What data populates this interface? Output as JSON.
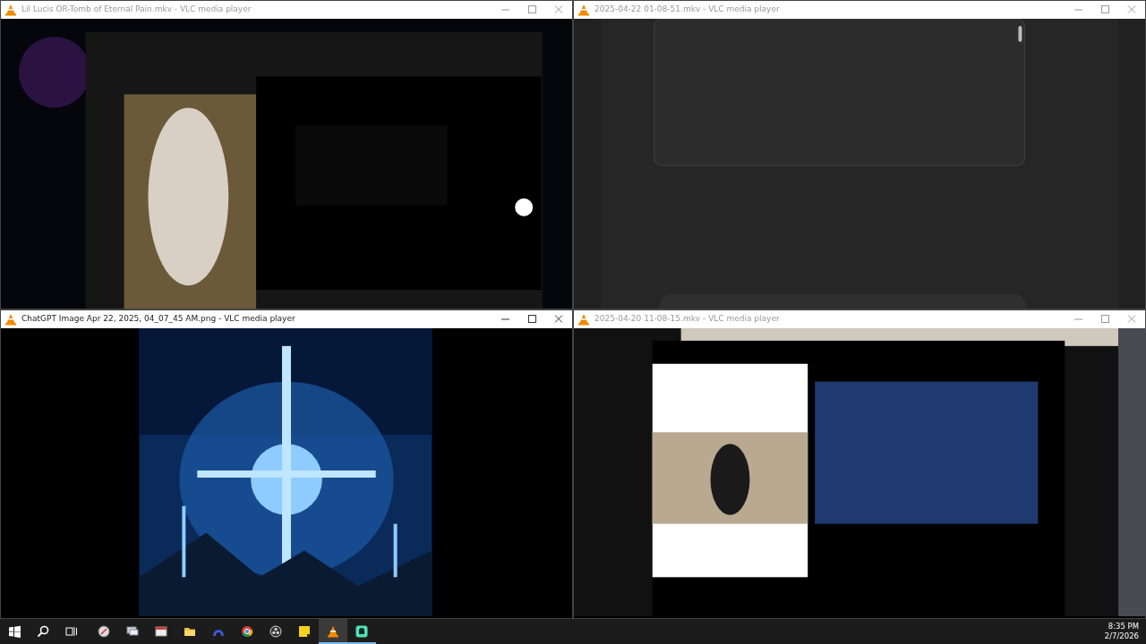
{
  "windows": [
    {
      "title": "Lil Lucis OR-Tomb of Eternal Pain.mkv - VLC media player",
      "active": false
    },
    {
      "title": "2025-04-22 01-08-51.mkv - VLC media player",
      "active": false
    },
    {
      "title": "ChatGPT Image Apr 22, 2025, 04_07_45 AM.png - VLC media player",
      "active": true
    },
    {
      "title": "2025-04-20 11-08-15.mkv - VLC media player",
      "active": false
    }
  ],
  "taskbar": {
    "buttons": [
      {
        "kind": "start",
        "running": false,
        "selected": false
      },
      {
        "kind": "search",
        "running": false,
        "selected": false
      },
      {
        "kind": "taskview",
        "running": false,
        "selected": false
      },
      {
        "kind": "compass",
        "running": false,
        "selected": false
      },
      {
        "kind": "monitor",
        "running": false,
        "selected": false
      },
      {
        "kind": "window",
        "running": false,
        "selected": false
      },
      {
        "kind": "folder",
        "running": false,
        "selected": false
      },
      {
        "kind": "arch",
        "running": false,
        "selected": false
      },
      {
        "kind": "browser",
        "running": false,
        "selected": false
      },
      {
        "kind": "aperture",
        "running": false,
        "selected": false
      },
      {
        "kind": "note",
        "running": false,
        "selected": false
      },
      {
        "kind": "cone",
        "running": true,
        "selected": true
      },
      {
        "kind": "chat",
        "running": true,
        "selected": false
      }
    ],
    "clock": {
      "time": "8:35 PM",
      "date": "2/7/2026"
    }
  }
}
